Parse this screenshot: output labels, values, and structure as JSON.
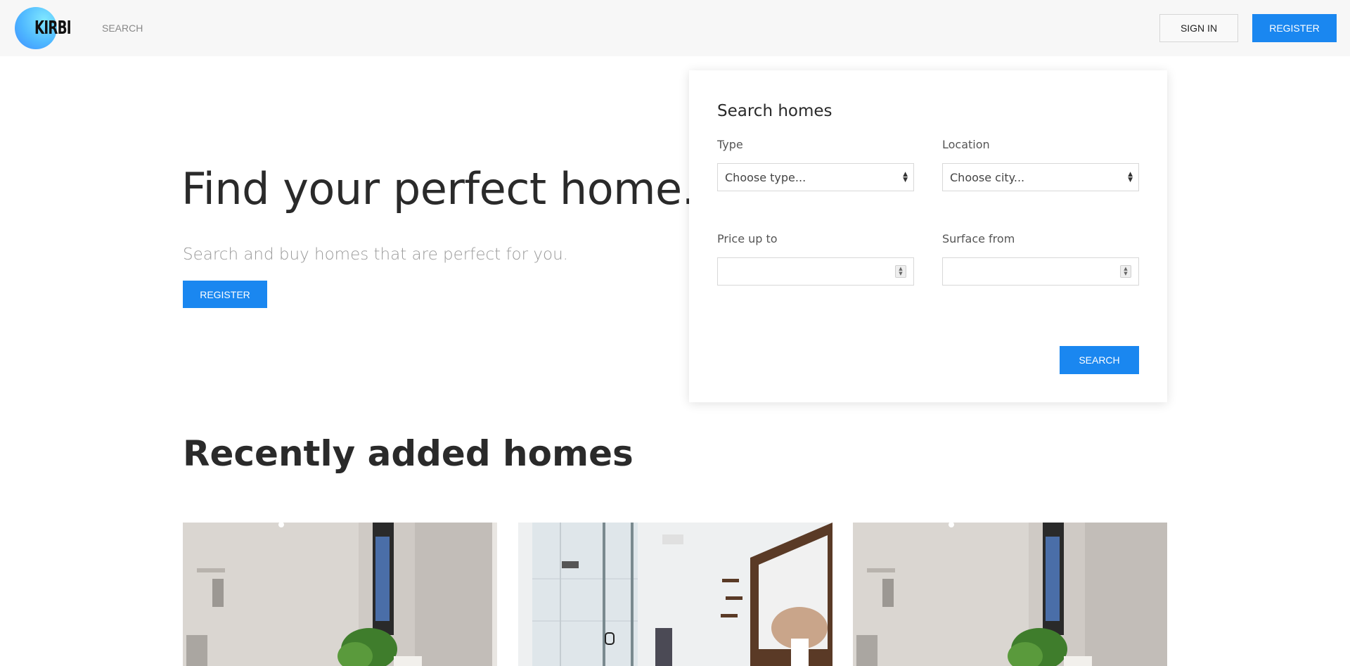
{
  "header": {
    "logo_text": "KIRBI",
    "nav_search": "SEARCH",
    "sign_in": "SIGN IN",
    "register": "REGISTER"
  },
  "hero": {
    "title": "Find your perfect home.",
    "subtitle": "Search and buy homes that are perfect for you.",
    "register": "REGISTER"
  },
  "search_card": {
    "title": "Search homes",
    "type_label": "Type",
    "type_value": "Choose type...",
    "location_label": "Location",
    "location_value": "Choose city...",
    "price_label": "Price up to",
    "surface_label": "Surface from",
    "search_button": "SEARCH"
  },
  "recent": {
    "title": "Recently added homes"
  },
  "colors": {
    "accent": "#1a87f0",
    "header_bg": "#f7f7f7"
  }
}
